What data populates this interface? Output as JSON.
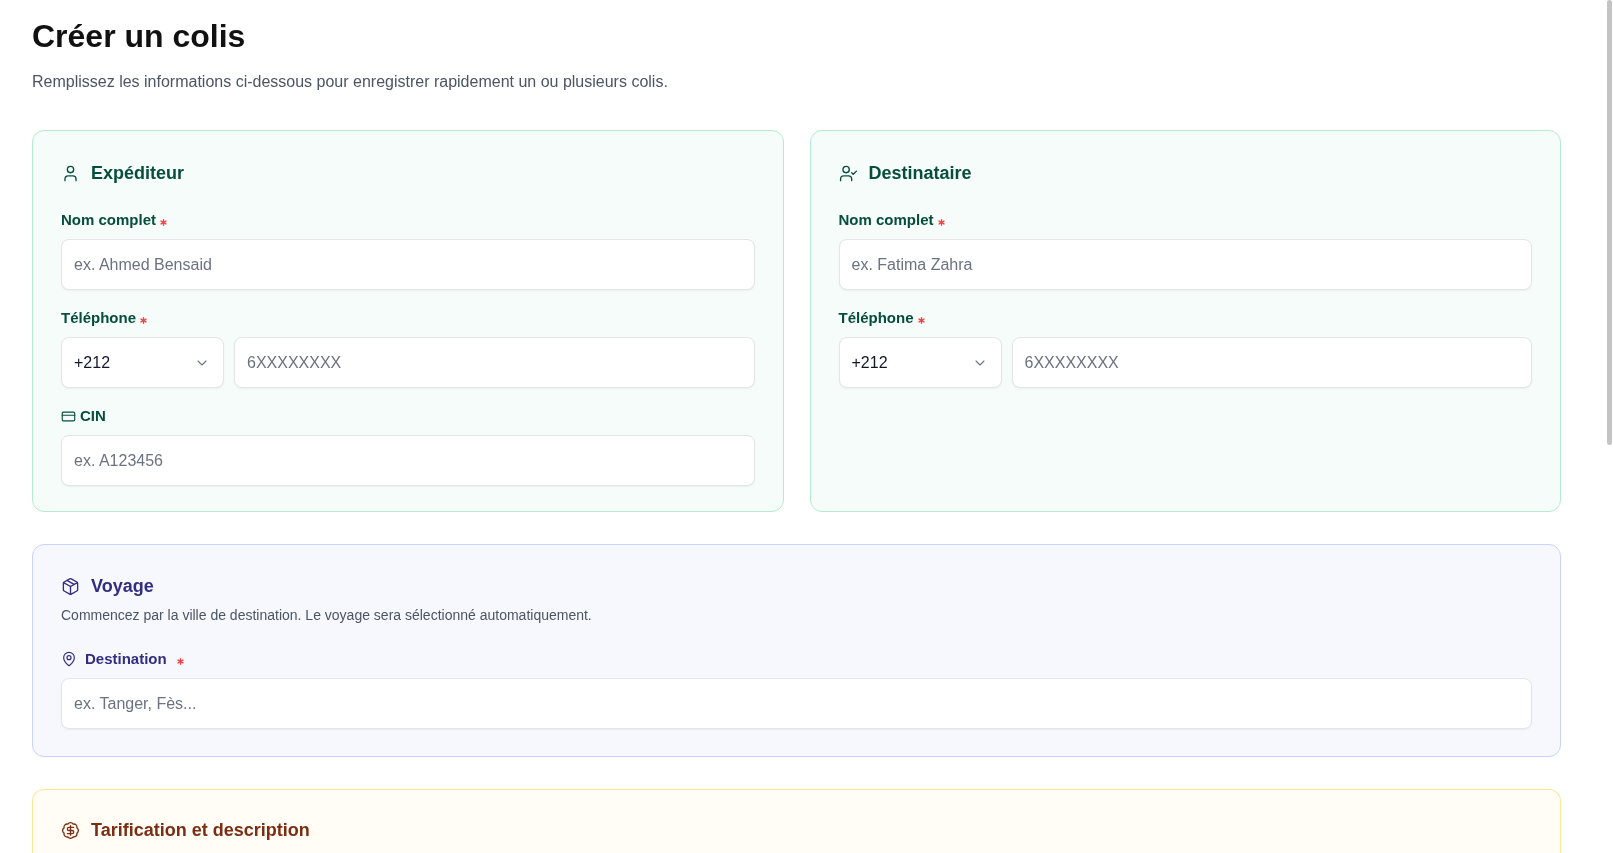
{
  "header": {
    "title": "Créer un colis",
    "subtitle": "Remplissez les informations ci-dessous pour enregistrer rapidement un ou plusieurs colis."
  },
  "sender": {
    "title": "Expéditeur",
    "fields": [
      {
        "kind": "name",
        "label": "Nom complet",
        "required": true,
        "placeholder": "ex. Ahmed Bensaid"
      },
      {
        "kind": "phone",
        "label": "Téléphone",
        "required": true,
        "country_code": "+212",
        "placeholder": "6XXXXXXXX"
      },
      {
        "kind": "document",
        "label": "CIN",
        "required": false,
        "placeholder": "ex. A123456"
      }
    ]
  },
  "recipient": {
    "title": "Destinataire",
    "fields": [
      {
        "kind": "name",
        "label": "Nom complet",
        "required": true,
        "placeholder": "ex. Fatima Zahra"
      },
      {
        "kind": "phone",
        "label": "Téléphone",
        "required": true,
        "country_code": "+212",
        "placeholder": "6XXXXXXXX"
      }
    ]
  },
  "trip": {
    "title": "Voyage",
    "description": "Commencez par la ville de destination. Le voyage sera sélectionné automatiquement.",
    "fields": [
      {
        "kind": "place",
        "label": "Destination",
        "required": true,
        "placeholder": "ex. Tanger, Fès..."
      }
    ]
  },
  "pricing": {
    "title": "Tarification et description"
  }
}
